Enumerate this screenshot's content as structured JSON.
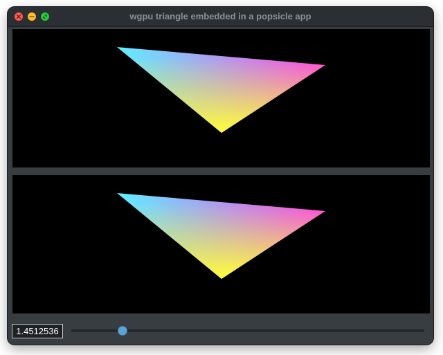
{
  "window": {
    "title": "wgpu triangle embedded in a popsicle app"
  },
  "titlebar_buttons": [
    {
      "name": "close",
      "color": "#fe5f57",
      "icon": "close-icon"
    },
    {
      "name": "minimize",
      "color": "#febc2e",
      "icon": "minimize-icon"
    },
    {
      "name": "maximize",
      "color": "#28c840",
      "icon": "maximize-icon"
    }
  ],
  "viewports": [
    {
      "name": "top-render",
      "vertex_colors": [
        "#5ff0ff",
        "#ff3ee6",
        "#ffff3a"
      ]
    },
    {
      "name": "bottom-render",
      "vertex_colors": [
        "#5ff0ff",
        "#ff3ee6",
        "#ffff3a"
      ]
    }
  ],
  "controls": {
    "value_text": "1.4512536",
    "slider": {
      "min": 0,
      "max": 10,
      "value": 1.4512536,
      "thumb_color": "#5ea3d6"
    }
  }
}
